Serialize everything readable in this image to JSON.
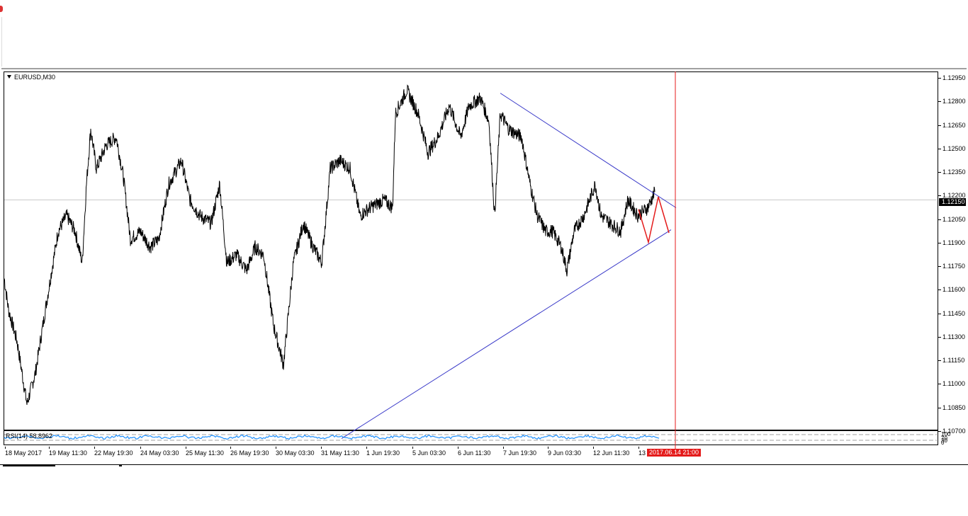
{
  "chart": {
    "symbol": "EURUSD,M30",
    "rsi_label": "RSI(14) 58.8962",
    "rsi_scale": [
      "100",
      "70",
      "30",
      "0"
    ],
    "current_price": "1.12150",
    "current_time": "2017.06.14 21:00",
    "price_ticks": [
      "1.12950",
      "1.12800",
      "1.12650",
      "1.12500",
      "1.12350",
      "1.12200",
      "1.12050",
      "1.11900",
      "1.11750",
      "1.11600",
      "1.11450",
      "1.11300",
      "1.11150",
      "1.11000",
      "1.10850",
      "1.10700"
    ],
    "time_ticks": [
      "18 May 2017",
      "19 May 11:30",
      "22 May 19:30",
      "24 May 03:30",
      "25 May 11:30",
      "26 May 19:30",
      "30 May 03:30",
      "31 May 11:30",
      "1 Jun 19:30",
      "5 Jun 03:30",
      "6 Jun 11:30",
      "7 Jun 19:30",
      "9 Jun 03:30",
      "12 Jun 11:30",
      "13"
    ]
  },
  "chart_data": {
    "type": "line",
    "title": "EURUSD,M30",
    "xlabel": "",
    "ylabel": "",
    "ylim": [
      1.107,
      1.1295
    ],
    "grid": false,
    "series": [
      {
        "name": "EURUSD,M30",
        "x": [
          "18 May 2017",
          "19 May 11:30",
          "22 May 19:30",
          "24 May 03:30",
          "25 May 11:30",
          "26 May 19:30",
          "30 May 03:30",
          "31 May 11:30",
          "1 Jun 19:30",
          "5 Jun 03:30",
          "6 Jun 11:30",
          "7 Jun 19:30",
          "9 Jun 03:30",
          "12 Jun 11:30",
          "13"
        ],
        "values": [
          1.1165,
          1.1195,
          1.1255,
          1.1185,
          1.124,
          1.1165,
          1.111,
          1.1225,
          1.1215,
          1.1265,
          1.126,
          1.1215,
          1.1175,
          1.12,
          1.1215
        ]
      }
    ],
    "current_price": 1.1215,
    "indicator": {
      "name": "RSI(14)",
      "value": 58.8962,
      "levels": [
        70,
        30
      ],
      "range": [
        0,
        100
      ]
    }
  },
  "colors": {
    "price_line": "#000000",
    "trendline": "#3838c8",
    "pattern": "#e41b1b",
    "cursor": "#e41b1b",
    "rsi_line": "#1e90ff"
  }
}
